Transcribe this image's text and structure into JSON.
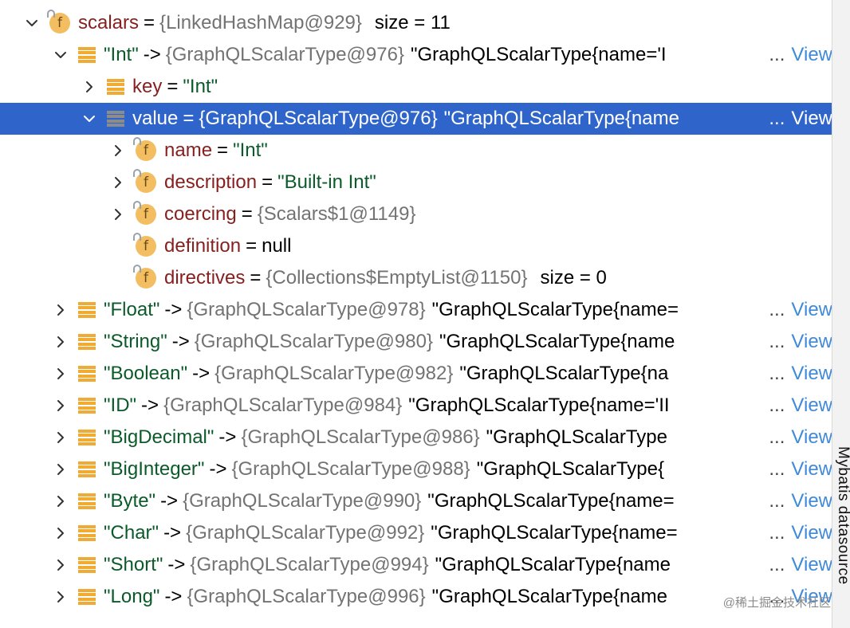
{
  "tree": {
    "rows": [
      {
        "indent": 0,
        "chevron": "down",
        "icon": "field-icon",
        "name": "scalars",
        "op": "=",
        "ref": "{LinkedHashMap@929}",
        "extra": "size = 11"
      },
      {
        "indent": 1,
        "chevron": "down",
        "icon": "map-entry-icon",
        "key": "\"Int\"",
        "op": "->",
        "ref": "{GraphQLScalarType@976}",
        "tail": "\"GraphQLScalarType{name='I",
        "dots": "...",
        "view": "View"
      },
      {
        "indent": 2,
        "chevron": "right",
        "icon": "map-entry-icon",
        "name": "key",
        "op": "=",
        "str": "\"Int\""
      },
      {
        "indent": 2,
        "chevron": "down",
        "icon": "map-entry-icon",
        "name": "value",
        "op": "=",
        "plain": "{GraphQLScalarType@976}",
        "tail": "\"GraphQLScalarType{name",
        "dots": "...",
        "view": "View",
        "selected": true
      },
      {
        "indent": 3,
        "chevron": "right",
        "icon": "field-icon",
        "name": "name",
        "op": "=",
        "str": "\"Int\""
      },
      {
        "indent": 3,
        "chevron": "right",
        "icon": "field-icon",
        "name": "description",
        "op": "=",
        "str": "\"Built-in Int\""
      },
      {
        "indent": 3,
        "chevron": "right",
        "icon": "field-icon",
        "name": "coercing",
        "op": "=",
        "ref": "{Scalars$1@1149}"
      },
      {
        "indent": 3,
        "chevron": "none",
        "icon": "field-icon",
        "name": "definition",
        "op": "=",
        "plain": "null"
      },
      {
        "indent": 3,
        "chevron": "none",
        "icon": "field-icon",
        "name": "directives",
        "op": "=",
        "ref": "{Collections$EmptyList@1150}",
        "extra": "size = 0"
      },
      {
        "indent": 1,
        "chevron": "right",
        "icon": "map-entry-icon",
        "key": "\"Float\"",
        "op": "->",
        "ref": "{GraphQLScalarType@978}",
        "tail": "\"GraphQLScalarType{name=",
        "dots": "...",
        "view": "View"
      },
      {
        "indent": 1,
        "chevron": "right",
        "icon": "map-entry-icon",
        "key": "\"String\"",
        "op": "->",
        "ref": "{GraphQLScalarType@980}",
        "tail": "\"GraphQLScalarType{name",
        "dots": "...",
        "view": "View"
      },
      {
        "indent": 1,
        "chevron": "right",
        "icon": "map-entry-icon",
        "key": "\"Boolean\"",
        "op": "->",
        "ref": "{GraphQLScalarType@982}",
        "tail": "\"GraphQLScalarType{na",
        "dots": "...",
        "view": "View"
      },
      {
        "indent": 1,
        "chevron": "right",
        "icon": "map-entry-icon",
        "key": "\"ID\"",
        "op": "->",
        "ref": "{GraphQLScalarType@984}",
        "tail": "\"GraphQLScalarType{name='II",
        "dots": "...",
        "view": "View"
      },
      {
        "indent": 1,
        "chevron": "right",
        "icon": "map-entry-icon",
        "key": "\"BigDecimal\"",
        "op": "->",
        "ref": "{GraphQLScalarType@986}",
        "tail": "\"GraphQLScalarType",
        "dots": "...",
        "view": "View"
      },
      {
        "indent": 1,
        "chevron": "right",
        "icon": "map-entry-icon",
        "key": "\"BigInteger\"",
        "op": "->",
        "ref": "{GraphQLScalarType@988}",
        "tail": "\"GraphQLScalarType{",
        "dots": "...",
        "view": "View"
      },
      {
        "indent": 1,
        "chevron": "right",
        "icon": "map-entry-icon",
        "key": "\"Byte\"",
        "op": "->",
        "ref": "{GraphQLScalarType@990}",
        "tail": "\"GraphQLScalarType{name=",
        "dots": "...",
        "view": "View"
      },
      {
        "indent": 1,
        "chevron": "right",
        "icon": "map-entry-icon",
        "key": "\"Char\"",
        "op": "->",
        "ref": "{GraphQLScalarType@992}",
        "tail": "\"GraphQLScalarType{name=",
        "dots": "...",
        "view": "View"
      },
      {
        "indent": 1,
        "chevron": "right",
        "icon": "map-entry-icon",
        "key": "\"Short\"",
        "op": "->",
        "ref": "{GraphQLScalarType@994}",
        "tail": "\"GraphQLScalarType{name",
        "dots": "...",
        "view": "View"
      },
      {
        "indent": 1,
        "chevron": "right",
        "icon": "map-entry-icon",
        "key": "\"Long\"",
        "op": "->",
        "ref": "{GraphQLScalarType@996}",
        "tail": "\"GraphQLScalarType{name",
        "dots": "...",
        "view": "View"
      }
    ]
  },
  "side_tab": {
    "label": "Mybatis datasource"
  },
  "watermark": {
    "text": "@稀土掘金技术社区"
  },
  "colors": {
    "selection": "#2f65ca",
    "field_name": "#871f1f",
    "string": "#0b5a2a",
    "reference": "#737373",
    "link": "#3f8ad8",
    "field_icon": "#f3be62",
    "entry_icon": "#efab33"
  }
}
